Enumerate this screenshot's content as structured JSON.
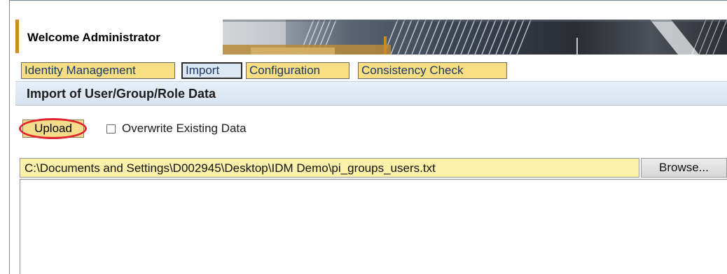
{
  "header": {
    "welcome_text": "Welcome Administrator",
    "accent_color": "#d48a1a"
  },
  "tabs": [
    {
      "label": "Identity Management",
      "active": false
    },
    {
      "label": "Import",
      "active": true
    },
    {
      "label": "Configuration",
      "active": false
    },
    {
      "label": "Consistency Check",
      "active": false
    }
  ],
  "section": {
    "title": "Import of User/Group/Role Data"
  },
  "upload": {
    "button_label": "Upload",
    "highlight_color": "#e0242e",
    "overwrite_checkbox": {
      "label": "Overwrite Existing Data",
      "checked": false
    }
  },
  "file": {
    "path_value": "C:\\Documents and Settings\\D002945\\Desktop\\IDM Demo\\pi_groups_users.txt",
    "browse_label": "Browse..."
  },
  "content": {
    "text_value": ""
  }
}
